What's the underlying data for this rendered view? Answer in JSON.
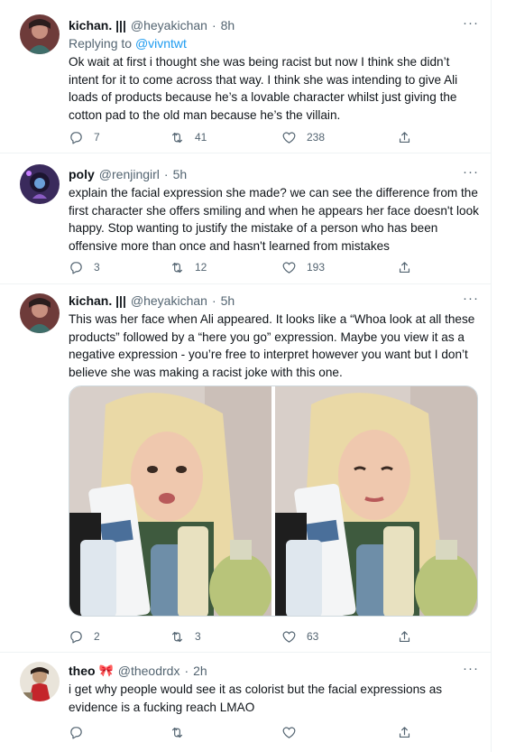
{
  "tweets": [
    {
      "name": "kichan. ||| ",
      "handle": "@heyakichan",
      "time": "8h",
      "reply_prefix": "Replying to ",
      "reply_to": "@vivntwt",
      "text": "Ok wait at first i thought she was being racist but now I think she didn’t intent for it to come across that way. I think she was intending to give Ali loads of products because he’s a lovable character whilst just giving the cotton pad to the old man because he’s the villain.",
      "replies": "7",
      "retweets": "41",
      "likes": "238"
    },
    {
      "name": "poly",
      "handle": "@renjingirl",
      "time": "5h",
      "text": "explain the facial expression she made? we can see the difference from the first character she offers smiling and when he appears her face doesn't look happy. Stop wanting to justify the mistake of a person who has been offensive more than once and hasn't learned from mistakes",
      "replies": "3",
      "retweets": "12",
      "likes": "193"
    },
    {
      "name": "kichan. ||| ",
      "handle": "@heyakichan",
      "time": "5h",
      "text": "This was her face when Ali appeared. It looks like a “Whoa look at all these products” followed by a “here you go” expression. Maybe you view it as a negative expression - you’re free to interpret however you want but I don’t believe she was making a racist joke with this one.",
      "replies": "2",
      "retweets": "3",
      "likes": "63"
    },
    {
      "name": "theo",
      "emoji": "🎀",
      "handle": "@theodrdx",
      "time": "2h",
      "text": "i get why people would see it as colorist but the facial expressions as evidence is a fucking reach LMAO"
    }
  ],
  "more_icon": "···",
  "colors": {
    "accent": "#1d9bf0",
    "muted": "#536471",
    "text": "#0f1419"
  }
}
